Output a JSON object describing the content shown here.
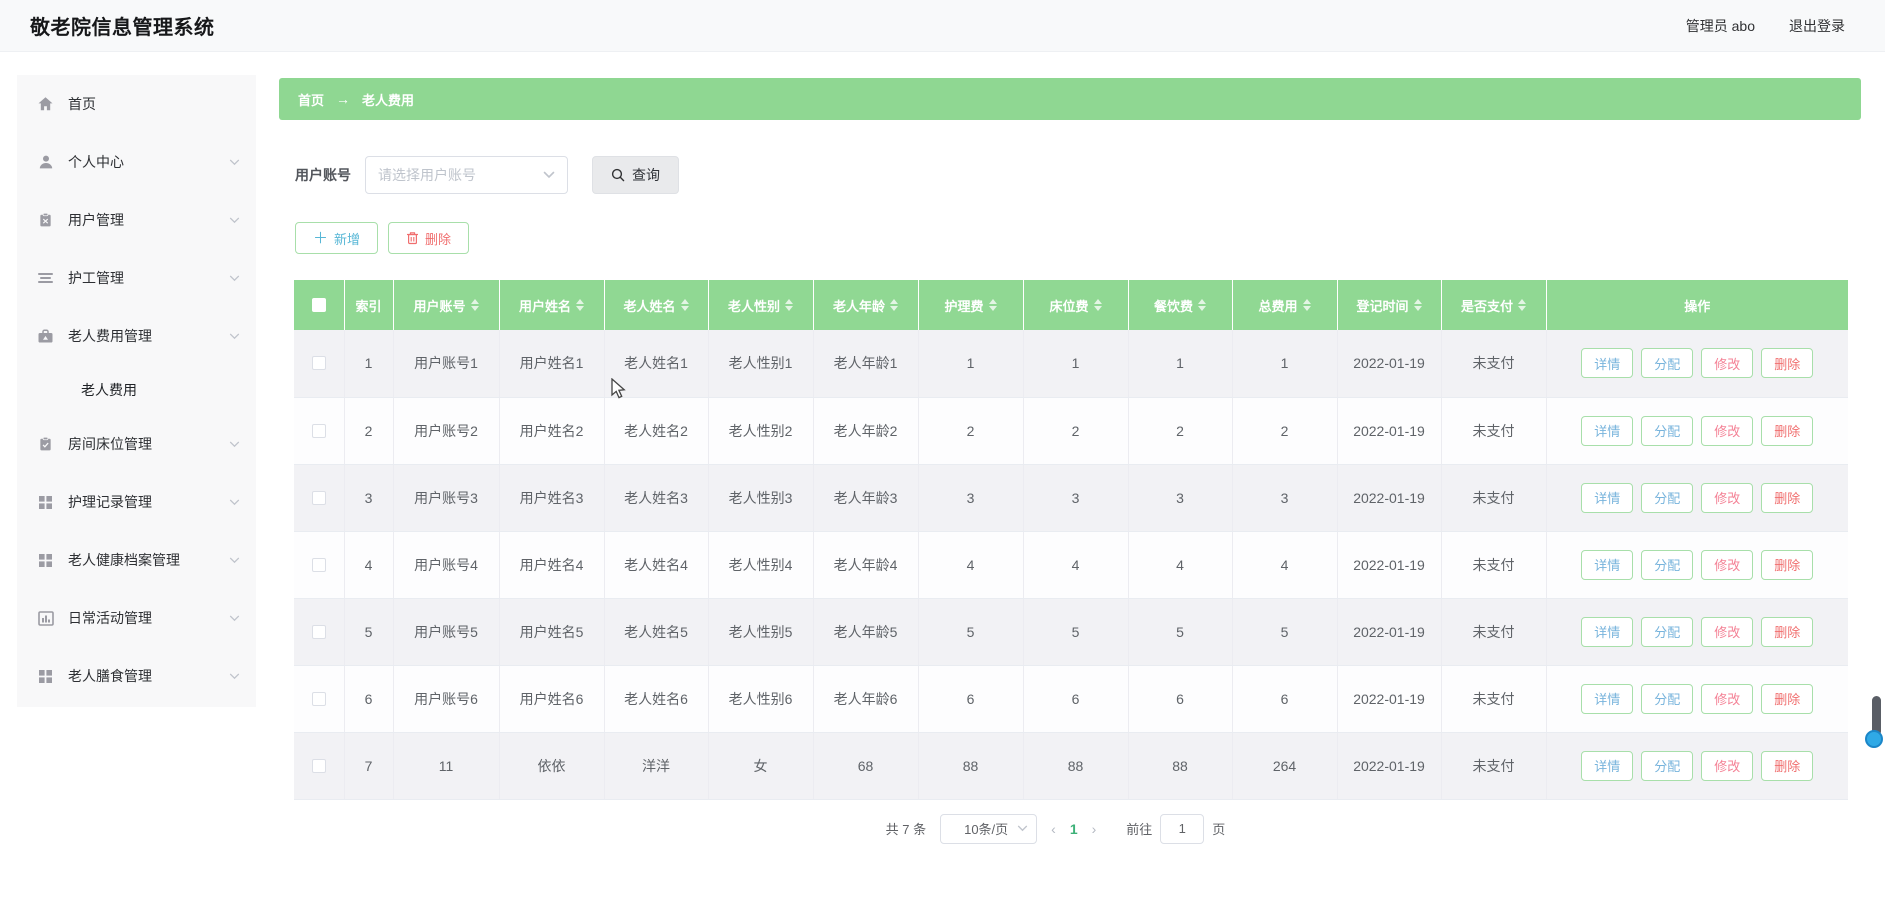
{
  "app": {
    "title": "敬老院信息管理系统",
    "user": "管理员 abo",
    "logout": "退出登录"
  },
  "sidebar": {
    "items": [
      {
        "label": "首页",
        "icon": "home-icon",
        "expandable": false,
        "sub": false
      },
      {
        "label": "个人中心",
        "icon": "user-icon",
        "expandable": true,
        "sub": false
      },
      {
        "label": "用户管理",
        "icon": "clipboard-icon",
        "expandable": true,
        "sub": false
      },
      {
        "label": "护工管理",
        "icon": "list-icon",
        "expandable": true,
        "sub": false
      },
      {
        "label": "老人费用管理",
        "icon": "finance-icon",
        "expandable": true,
        "sub": false,
        "expanded": true
      },
      {
        "label": "老人费用",
        "icon": null,
        "expandable": false,
        "sub": true,
        "active": true
      },
      {
        "label": "房间床位管理",
        "icon": "clipboard-check-icon",
        "expandable": true,
        "sub": false
      },
      {
        "label": "护理记录管理",
        "icon": "grid-icon",
        "expandable": true,
        "sub": false
      },
      {
        "label": "老人健康档案管理",
        "icon": "grid-icon",
        "expandable": true,
        "sub": false
      },
      {
        "label": "日常活动管理",
        "icon": "bar-chart-icon",
        "expandable": true,
        "sub": false
      },
      {
        "label": "老人膳食管理",
        "icon": "grid-icon",
        "expandable": true,
        "sub": false
      }
    ]
  },
  "breadcrumb": {
    "home": "首页",
    "separator": "→",
    "current": "老人费用"
  },
  "search": {
    "label": "用户账号",
    "placeholder": "请选择用户账号",
    "button": "查询"
  },
  "toolbar": {
    "add": "新增",
    "add_plus": "＋",
    "delete": "删除"
  },
  "table": {
    "headers": [
      {
        "label": "索引",
        "sortable": false
      },
      {
        "label": "用户账号",
        "sortable": true
      },
      {
        "label": "用户姓名",
        "sortable": true
      },
      {
        "label": "老人姓名",
        "sortable": true
      },
      {
        "label": "老人性别",
        "sortable": true
      },
      {
        "label": "老人年龄",
        "sortable": true
      },
      {
        "label": "护理费",
        "sortable": true
      },
      {
        "label": "床位费",
        "sortable": true
      },
      {
        "label": "餐饮费",
        "sortable": true
      },
      {
        "label": "总费用",
        "sortable": true
      },
      {
        "label": "登记时间",
        "sortable": true
      },
      {
        "label": "是否支付",
        "sortable": true
      },
      {
        "label": "操作",
        "sortable": false
      }
    ],
    "rows": [
      [
        "1",
        "用户账号1",
        "用户姓名1",
        "老人姓名1",
        "老人性别1",
        "老人年龄1",
        "1",
        "1",
        "1",
        "1",
        "2022-01-19",
        "未支付"
      ],
      [
        "2",
        "用户账号2",
        "用户姓名2",
        "老人姓名2",
        "老人性别2",
        "老人年龄2",
        "2",
        "2",
        "2",
        "2",
        "2022-01-19",
        "未支付"
      ],
      [
        "3",
        "用户账号3",
        "用户姓名3",
        "老人姓名3",
        "老人性别3",
        "老人年龄3",
        "3",
        "3",
        "3",
        "3",
        "2022-01-19",
        "未支付"
      ],
      [
        "4",
        "用户账号4",
        "用户姓名4",
        "老人姓名4",
        "老人性别4",
        "老人年龄4",
        "4",
        "4",
        "4",
        "4",
        "2022-01-19",
        "未支付"
      ],
      [
        "5",
        "用户账号5",
        "用户姓名5",
        "老人姓名5",
        "老人性别5",
        "老人年龄5",
        "5",
        "5",
        "5",
        "5",
        "2022-01-19",
        "未支付"
      ],
      [
        "6",
        "用户账号6",
        "用户姓名6",
        "老人姓名6",
        "老人性别6",
        "老人年龄6",
        "6",
        "6",
        "6",
        "6",
        "2022-01-19",
        "未支付"
      ],
      [
        "7",
        "11",
        "依依",
        "洋洋",
        "女",
        "68",
        "88",
        "88",
        "88",
        "264",
        "2022-01-19",
        "未支付"
      ]
    ],
    "actions": [
      "详情",
      "分配",
      "修改",
      "删除"
    ]
  },
  "pagination": {
    "total": "共 7 条",
    "page_size": "10条/页",
    "prev": "‹",
    "current": "1",
    "next": "›",
    "goto_label": "前往",
    "goto_value": "1",
    "unit": "页"
  },
  "colors": {
    "header_green": "#90d893",
    "breadcrumb_green": "#8fd792",
    "button_border_green": "#a8dfaa",
    "action_blue": "#78b4dc",
    "action_pink": "#f48296",
    "action_red": "#f06e6e",
    "add_blue": "#58b7d6",
    "page_active_green": "#3db178",
    "scroll_dot_blue": "#2fa9e6"
  }
}
